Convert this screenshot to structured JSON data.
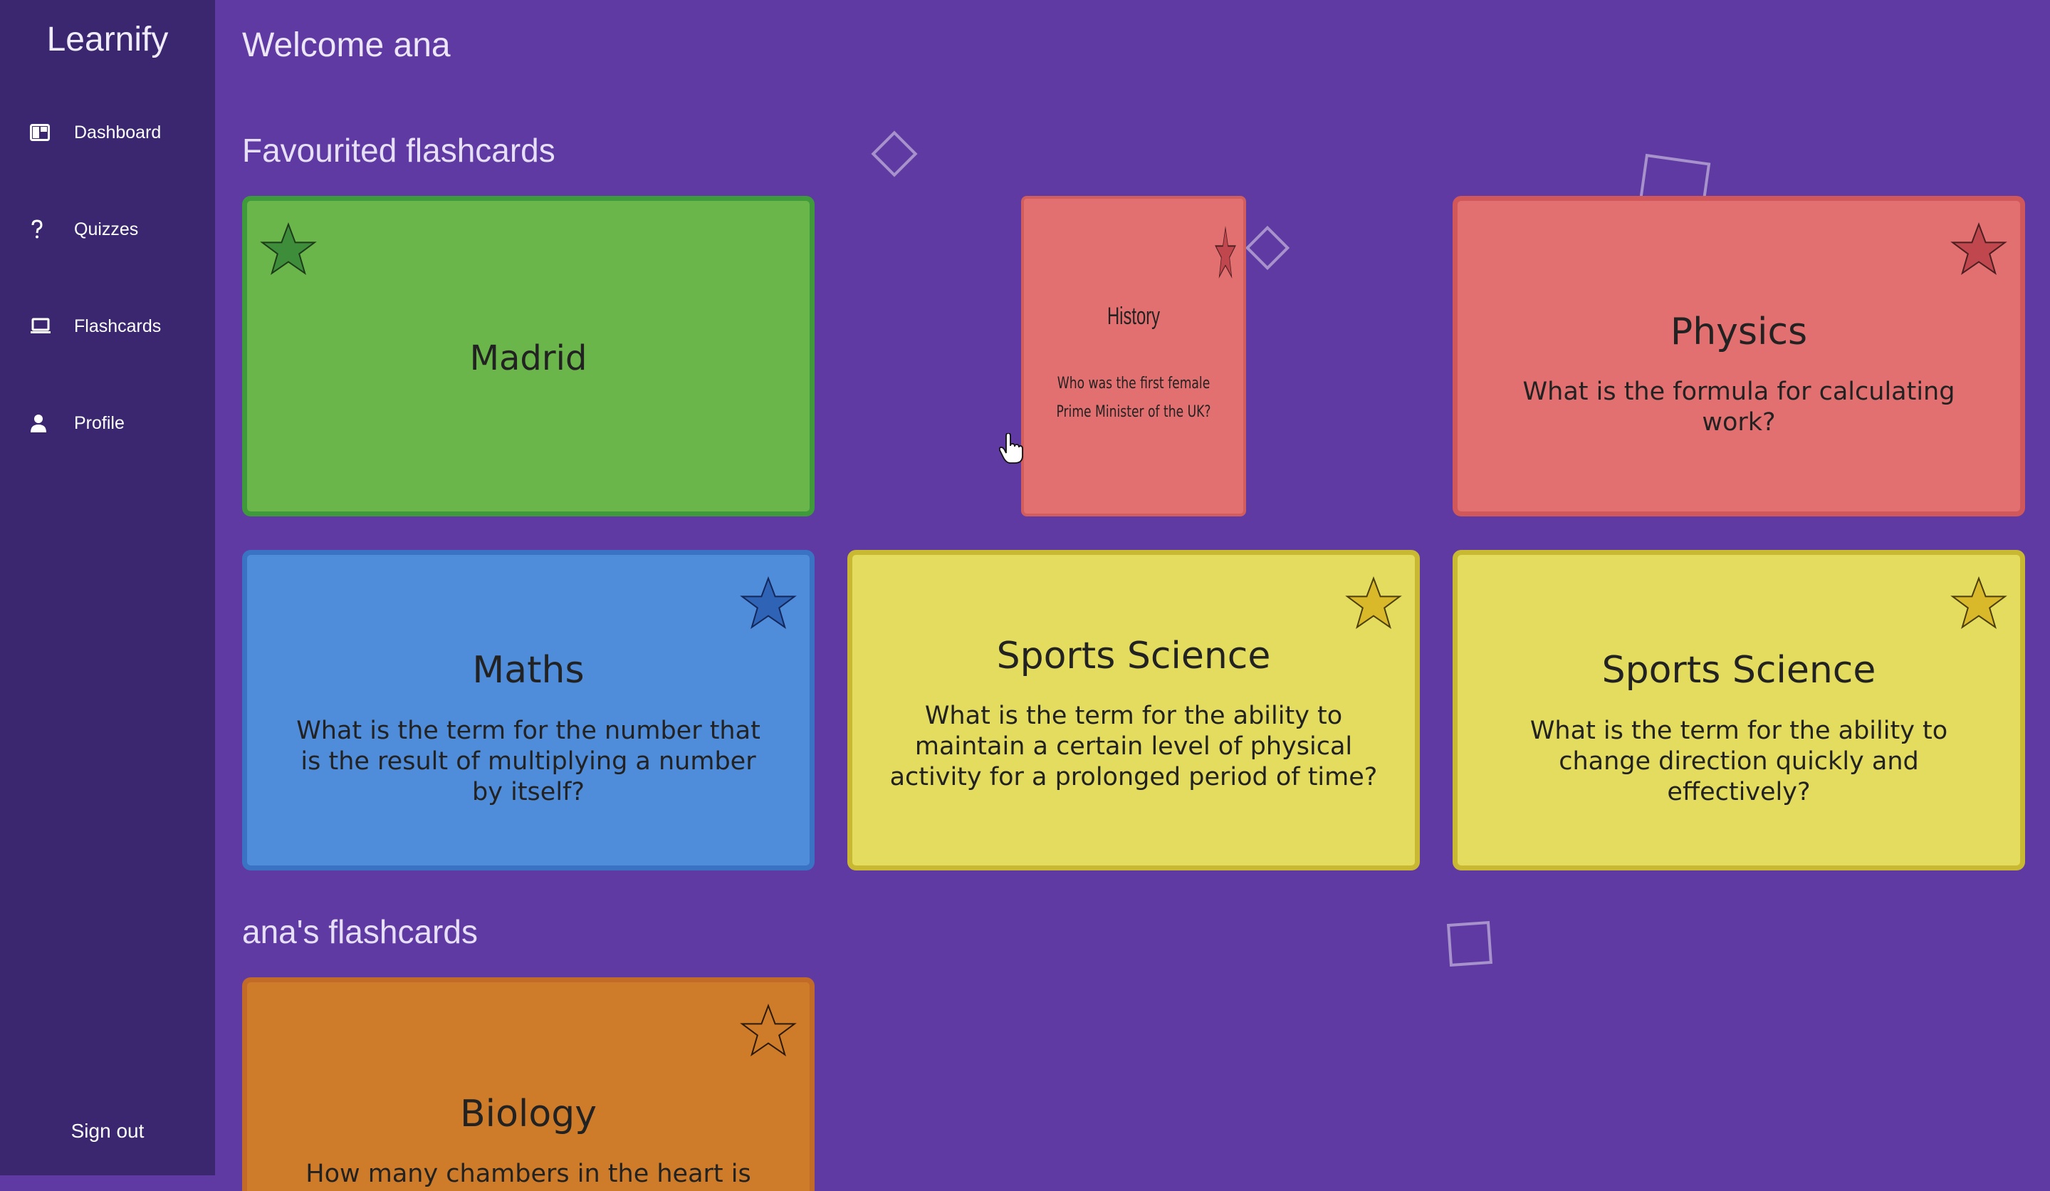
{
  "app": {
    "title": "Learnify"
  },
  "sidebar": {
    "items": [
      {
        "label": "Dashboard",
        "icon": "dashboard-icon"
      },
      {
        "label": "Quizzes",
        "icon": "question-icon"
      },
      {
        "label": "Flashcards",
        "icon": "laptop-icon"
      },
      {
        "label": "Profile",
        "icon": "person-icon"
      }
    ],
    "sign_out": "Sign out"
  },
  "header": {
    "welcome": "Welcome ana"
  },
  "sections": {
    "favourited": "Favourited flashcards",
    "mine": "ana's flashcards"
  },
  "colors": {
    "background": "#5f3aa3",
    "sidebar": "#3a2770",
    "green": "#6ab64a",
    "red": "#e37070",
    "blue": "#4f8cd9",
    "yellow": "#e3dc5f",
    "orange": "#cf7c2a"
  },
  "favourited_cards": [
    {
      "subject": "",
      "question": "Madrid",
      "color": "green",
      "favourite": true
    },
    {
      "subject": "History",
      "question": "Who was the first female Prime Minister of the UK?",
      "color": "red",
      "favourite": true,
      "state": "flipping"
    },
    {
      "subject": "Physics",
      "question": "What is the formula for calculating work?",
      "color": "red",
      "favourite": true
    },
    {
      "subject": "Maths",
      "question": "What is the term for the number that is the result of multiplying a number by itself?",
      "color": "blue",
      "favourite": true
    },
    {
      "subject": "Sports Science",
      "question": "What is the term for the ability to maintain a certain level of physical activity for a prolonged period of time?",
      "color": "yellow",
      "favourite": true
    },
    {
      "subject": "Sports Science",
      "question": "What is the term for the ability to change direction quickly and effectively?",
      "color": "yellow",
      "favourite": true
    }
  ],
  "my_cards": [
    {
      "subject": "Biology",
      "question": "How many chambers in the heart is there?",
      "color": "orange",
      "favourite": false
    }
  ]
}
